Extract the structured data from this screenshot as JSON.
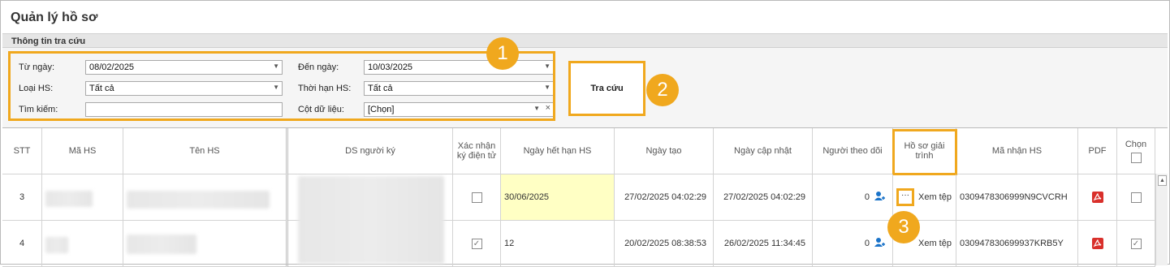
{
  "window": {
    "title": "Quản lý hồ sơ"
  },
  "search_panel": {
    "header": "Thông tin tra cứu",
    "from_date": {
      "label": "Từ ngày:",
      "value": "08/02/2025"
    },
    "to_date": {
      "label": "Đến ngày:",
      "value": "10/03/2025"
    },
    "record_type": {
      "label": "Loại HS:",
      "value": "Tất cả"
    },
    "deadline": {
      "label": "Thời hạn HS:",
      "value": "Tất cả"
    },
    "search": {
      "label": "Tìm kiếm:",
      "value": ""
    },
    "data_columns": {
      "label": "Cột dữ liệu:",
      "value": "[Chọn]"
    },
    "search_button": "Tra cứu"
  },
  "callouts": [
    "1",
    "2",
    "3"
  ],
  "table": {
    "headers": {
      "stt": "STT",
      "ma_hs": "Mã HS",
      "ten_hs": "Tên HS",
      "ds_nguoi_ky": "DS người ký",
      "xac_nhan": "Xác nhận ký điện tử",
      "ngay_het_han": "Ngày hết hạn HS",
      "ngay_tao": "Ngày tạo",
      "ngay_cap_nhat": "Ngày cập nhật",
      "nguoi_theo_doi": "Người theo dõi",
      "ho_so_giai_trinh": "Hồ sơ giải trình",
      "ma_nhan_hs": "Mã nhận HS",
      "pdf": "PDF",
      "chon": "Chọn"
    },
    "rows": [
      {
        "stt": "3",
        "xac_nhan_checked": false,
        "ngay_het_han": "30/06/2025",
        "ngay_tao": "27/02/2025 04:02:29",
        "ngay_cap_nhat": "27/02/2025 04:02:29",
        "nguoi_theo_doi": "0",
        "giai_trinh_btn": "···",
        "xem_tep": "Xem tệp",
        "ma_nhan_hs": "0309478306999N9CVCRH",
        "chon_checked": false
      },
      {
        "stt": "4",
        "xac_nhan_checked": true,
        "ngay_het_han": "12",
        "ngay_tao": "20/02/2025 08:38:53",
        "ngay_cap_nhat": "26/02/2025 11:34:45",
        "nguoi_theo_doi": "0",
        "giai_trinh_btn": "···",
        "xem_tep": "Xem tệp",
        "ma_nhan_hs": "030947830699937KRB5Y",
        "chon_checked": true
      }
    ]
  },
  "colors": {
    "highlight": "#f0a81e",
    "expired_cell": "#ffffc4",
    "pdf_red": "#d9302b",
    "person_blue": "#1a73c9"
  }
}
